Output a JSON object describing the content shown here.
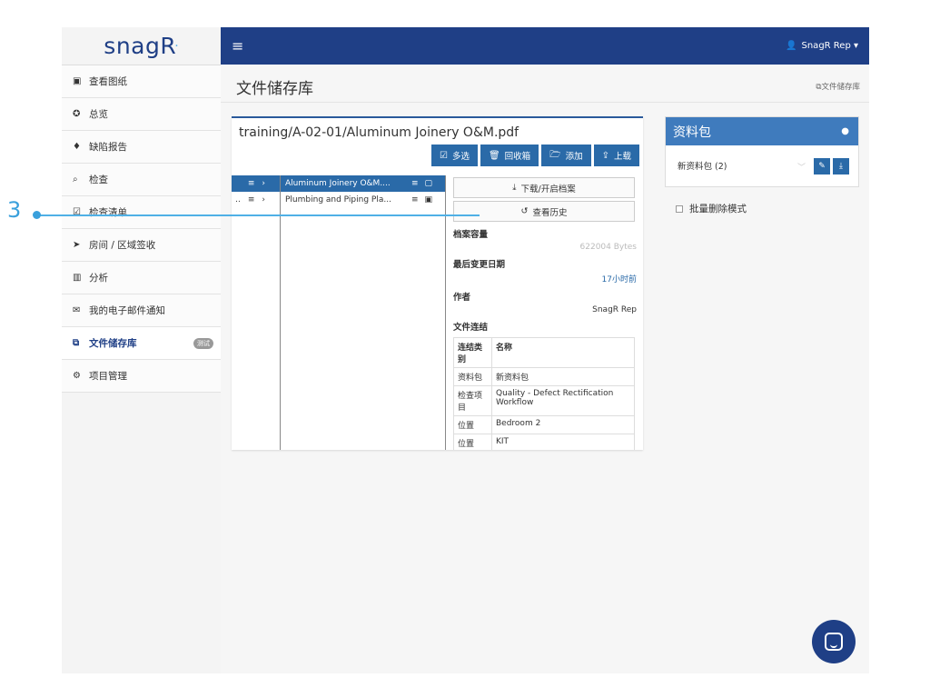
{
  "sidebar": {
    "logo": "snagR",
    "items": [
      {
        "icon": "image-icon",
        "glyph": "▣",
        "label": "查看图纸"
      },
      {
        "icon": "dashboard-icon",
        "glyph": "✪",
        "label": "总览"
      },
      {
        "icon": "map-marker-icon",
        "glyph": "♦",
        "label": "缺陷报告"
      },
      {
        "icon": "search-icon",
        "glyph": "⌕",
        "label": "检查"
      },
      {
        "icon": "checklist-icon",
        "glyph": "☑",
        "label": "检查清单"
      },
      {
        "icon": "location-arrow-icon",
        "glyph": "➤",
        "label": "房间 / 区域签收"
      },
      {
        "icon": "bar-chart-icon",
        "glyph": "▥",
        "label": "分析"
      },
      {
        "icon": "envelope-icon",
        "glyph": "✉",
        "label": "我的电子邮件通知"
      },
      {
        "icon": "copy-icon",
        "glyph": "⧉",
        "label": "文件储存库",
        "badge": "测试"
      },
      {
        "icon": "cogs-icon",
        "glyph": "⚙",
        "label": "项目管理"
      }
    ]
  },
  "topbar": {
    "menu_glyph": "≡",
    "user_glyph": "👤",
    "user": "SnagR Rep ▾"
  },
  "page": {
    "title": "文件储存库",
    "breadcrumb": "⧉文件储存库"
  },
  "files": {
    "path": "training/A-02-01/Aluminum Joinery O&M.pdf",
    "buttons": {
      "multi": "多选",
      "recycle": "回收箱",
      "add": "添加",
      "upload": "上载"
    },
    "col1": [
      {
        "prefix": "",
        "menu": "≡",
        "chevron": "›"
      },
      {
        "prefix": "..",
        "menu": "≡",
        "chevron": "›"
      }
    ],
    "col2": [
      {
        "name": "Aluminum Joinery O&M....",
        "menu": "≡",
        "icon": "▢"
      },
      {
        "name": "Plumbing and Piping Pla...",
        "menu": "≡",
        "icon": "▣"
      }
    ]
  },
  "detail": {
    "download": "下载/开启档案",
    "history": "查看历史",
    "size_label": "档案容量",
    "size_value": "622004 Bytes",
    "modified_label": "最后变更日期",
    "modified_value": "17小时前",
    "author_label": "作者",
    "author_value": "SnagR Rep",
    "links_label": "文件连结",
    "links_header": {
      "type": "连结类别",
      "name": "名称"
    },
    "links": [
      {
        "type": "资料包",
        "name": "新资料包"
      },
      {
        "type": "检查项目",
        "name": "Quality - Defect Rectification Workflow"
      },
      {
        "type": "位置",
        "name": "Bedroom 2"
      },
      {
        "type": "位置",
        "name": "KIT"
      }
    ]
  },
  "packages": {
    "title": "资料包",
    "item": "新资料包 (2)",
    "bulk_delete": "批量删除模式"
  },
  "annotation": {
    "number": "3"
  }
}
